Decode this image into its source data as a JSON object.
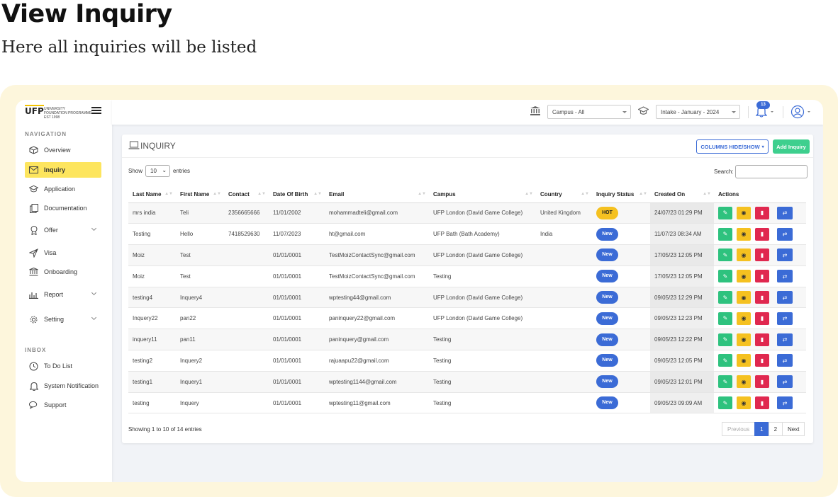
{
  "hero": {
    "title": "View Inquiry",
    "subtitle": "Here all inquiries will be listed"
  },
  "logo": {
    "mark": "UFP",
    "line1": "UNIVERSITY",
    "line2": "FOUNDATION PROGRAMME",
    "line3": "EST 1998"
  },
  "sidebar": {
    "navigation_title": "NAVIGATION",
    "items": [
      {
        "label": "Overview",
        "icon": "cube-icon",
        "active": false
      },
      {
        "label": "Inquiry",
        "icon": "envelope-icon",
        "active": true
      },
      {
        "label": "Application",
        "icon": "graduation-cap-icon",
        "active": false
      },
      {
        "label": "Documentation",
        "icon": "documents-icon",
        "active": false
      },
      {
        "label": "Offer",
        "icon": "award-icon",
        "active": false,
        "expandable": true
      },
      {
        "label": "Visa",
        "icon": "plane-icon",
        "active": false
      },
      {
        "label": "Onboarding",
        "icon": "bank-icon",
        "active": false
      },
      {
        "label": "Report",
        "icon": "bar-chart-icon",
        "active": false,
        "expandable": true
      },
      {
        "label": "Setting",
        "icon": "gear-icon",
        "active": false,
        "expandable": true
      }
    ],
    "inbox_title": "INBOX",
    "inbox_items": [
      {
        "label": "To Do List",
        "icon": "clock-icon"
      },
      {
        "label": "System Notification",
        "icon": "bell-icon"
      },
      {
        "label": "Support",
        "icon": "chat-icon"
      }
    ]
  },
  "topbar": {
    "campus": "Campus - All",
    "intake": "Intake - January - 2024",
    "notification_count": "13"
  },
  "card": {
    "title": "INQUIRY",
    "columns_button": "COLUMNS HIDE/SHOW",
    "add_button": "Add Inquiry",
    "show_label": "Show",
    "entries_value": "10",
    "entries_label": "entries",
    "search_label": "Search:",
    "footer": "Showing 1 to 10 of 14 entries",
    "pager": {
      "prev": "Previous",
      "p1": "1",
      "p2": "2",
      "next": "Next"
    }
  },
  "table": {
    "headers": [
      "Last Name",
      "First Name",
      "Contact",
      "Date Of Birth",
      "Email",
      "Campus",
      "Country",
      "Inquiry Status",
      "Created On",
      "Actions"
    ],
    "rows": [
      {
        "last": "mrs india",
        "first": "Teli",
        "contact": "2356665666",
        "dob": "11/01/2002",
        "email": "mohammadteli@gmail.com",
        "campus": "UFP London (David Game College)",
        "country": "United Kingdom",
        "status": "HOT",
        "created": "24/07/23 01:29 PM"
      },
      {
        "last": "Testing",
        "first": "Hello",
        "contact": "7418529630",
        "dob": "11/07/2023",
        "email": "ht@gmail.com",
        "campus": "UFP Bath (Bath Academy)",
        "country": "India",
        "status": "New",
        "created": "11/07/23 08:34 AM"
      },
      {
        "last": "Moiz",
        "first": "Test",
        "contact": "",
        "dob": "01/01/0001",
        "email": "TestMoizContactSync@gmail.com",
        "campus": "UFP London (David Game College)",
        "country": "",
        "status": "New",
        "created": "17/05/23 12:05 PM"
      },
      {
        "last": "Moiz",
        "first": "Test",
        "contact": "",
        "dob": "01/01/0001",
        "email": "TestMoizContactSync@gmail.com",
        "campus": "Testing",
        "country": "",
        "status": "New",
        "created": "17/05/23 12:05 PM"
      },
      {
        "last": "testing4",
        "first": "Inquery4",
        "contact": "",
        "dob": "01/01/0001",
        "email": "wptesting44@gmail.com",
        "campus": "UFP London (David Game College)",
        "country": "",
        "status": "New",
        "created": "09/05/23 12:29 PM"
      },
      {
        "last": "Inquery22",
        "first": "pan22",
        "contact": "",
        "dob": "01/01/0001",
        "email": "paninquery22@gmail.com",
        "campus": "UFP London (David Game College)",
        "country": "",
        "status": "New",
        "created": "09/05/23 12:23 PM"
      },
      {
        "last": "inquery11",
        "first": "pan11",
        "contact": "",
        "dob": "01/01/0001",
        "email": "paninquery@gmail.com",
        "campus": "Testing",
        "country": "",
        "status": "New",
        "created": "09/05/23 12:22 PM"
      },
      {
        "last": "testing2",
        "first": "Inquery2",
        "contact": "",
        "dob": "01/01/0001",
        "email": "rajuaapu22@gmail.com",
        "campus": "Testing",
        "country": "",
        "status": "New",
        "created": "09/05/23 12:05 PM"
      },
      {
        "last": "testing1",
        "first": "Inquery1",
        "contact": "",
        "dob": "01/01/0001",
        "email": "wptesting1144@gmail.com",
        "campus": "Testing",
        "country": "",
        "status": "New",
        "created": "09/05/23 12:01 PM"
      },
      {
        "last": "testing",
        "first": "Inquery",
        "contact": "",
        "dob": "01/01/0001",
        "email": "wptesting11@gmail.com",
        "campus": "Testing",
        "country": "",
        "status": "New",
        "created": "09/05/23 09:09 AM"
      }
    ]
  },
  "colors": {
    "accent": "#3b6bd6",
    "active_nav": "#fde55e",
    "hot": "#f5c120",
    "edit": "#2ec27e",
    "delete": "#e0284f",
    "frame": "#fdf6dc"
  }
}
